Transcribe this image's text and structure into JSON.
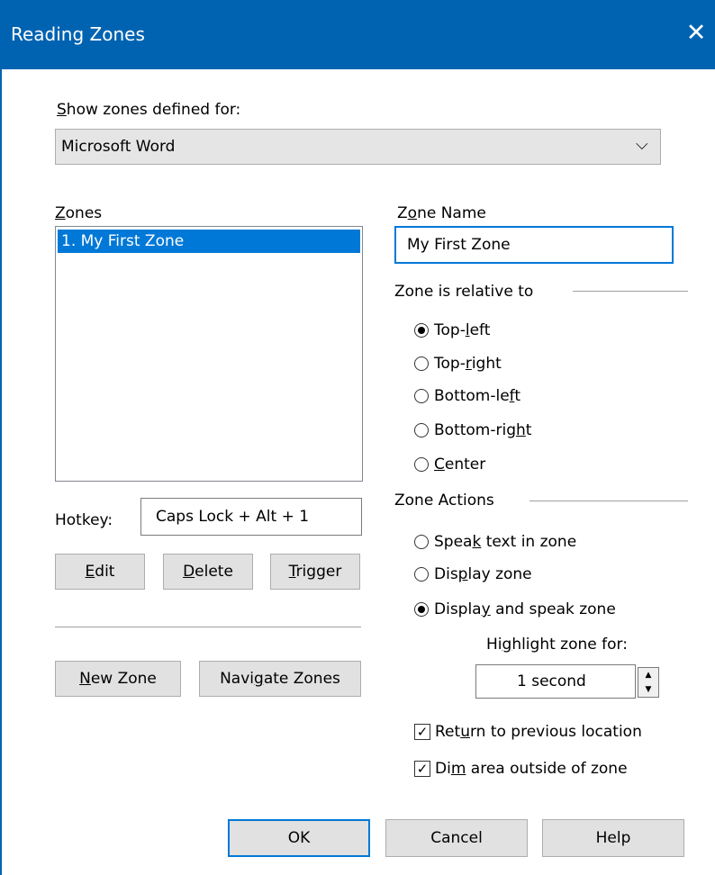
{
  "window": {
    "title": "Reading Zones",
    "close_glyph": "✕"
  },
  "show_zones": {
    "label_accel": "S",
    "label_rest": "how zones defined for:",
    "selected": "Microsoft Word",
    "dropdown_glyph": "⌵"
  },
  "zones": {
    "label_accel": "Z",
    "label_rest": "ones",
    "items": [
      "1. My First Zone"
    ]
  },
  "hotkey": {
    "label": "Hotkey:",
    "value": "Caps Lock + Alt + 1"
  },
  "buttons": {
    "edit": {
      "accel": "E",
      "rest": "dit"
    },
    "delete": {
      "accel": "D",
      "rest": "elete"
    },
    "trigger": {
      "accel": "T",
      "rest": "rigger"
    },
    "new_zone": {
      "accel": "N",
      "rest": "ew Zone"
    },
    "navigate_zones": {
      "pre": "Navi",
      "accel": "g",
      "rest": "ate Zones"
    },
    "ok": "OK",
    "cancel": "Cancel",
    "help": "Help"
  },
  "zone_name": {
    "pre": "Z",
    "accel": "o",
    "rest": "ne Name",
    "value": "My First Zone"
  },
  "relative": {
    "label": "Zone is relative to",
    "options": [
      {
        "pre": "Top-",
        "accel": "l",
        "rest": "eft",
        "checked": true
      },
      {
        "pre": "Top-",
        "accel": "r",
        "rest": "ight",
        "checked": false
      },
      {
        "pre": "Bottom-le",
        "accel": "f",
        "rest": "t",
        "checked": false
      },
      {
        "pre": "Bottom-rig",
        "accel": "h",
        "rest": "t",
        "checked": false
      },
      {
        "pre": "",
        "accel": "C",
        "rest": "enter",
        "checked": false
      }
    ]
  },
  "actions": {
    "label": "Zone Actions",
    "options": [
      {
        "pre": "Spea",
        "accel": "k",
        "rest": " text in zone",
        "checked": false
      },
      {
        "pre": "Dis",
        "accel": "p",
        "rest": "lay zone",
        "checked": false
      },
      {
        "pre": "Displa",
        "accel": "y",
        "rest": " and speak zone",
        "checked": true
      }
    ]
  },
  "highlight": {
    "pre": "Hi",
    "accel": "g",
    "rest": "hlight zone for:",
    "value": "1 second",
    "up_glyph": "▲",
    "down_glyph": "▼"
  },
  "checkboxes": [
    {
      "pre": "Ret",
      "accel": "u",
      "rest": "rn to previous location",
      "checked": true
    },
    {
      "pre": "Di",
      "accel": "m",
      "rest": " area outside of zone",
      "checked": true
    }
  ],
  "check_glyph": "✓"
}
